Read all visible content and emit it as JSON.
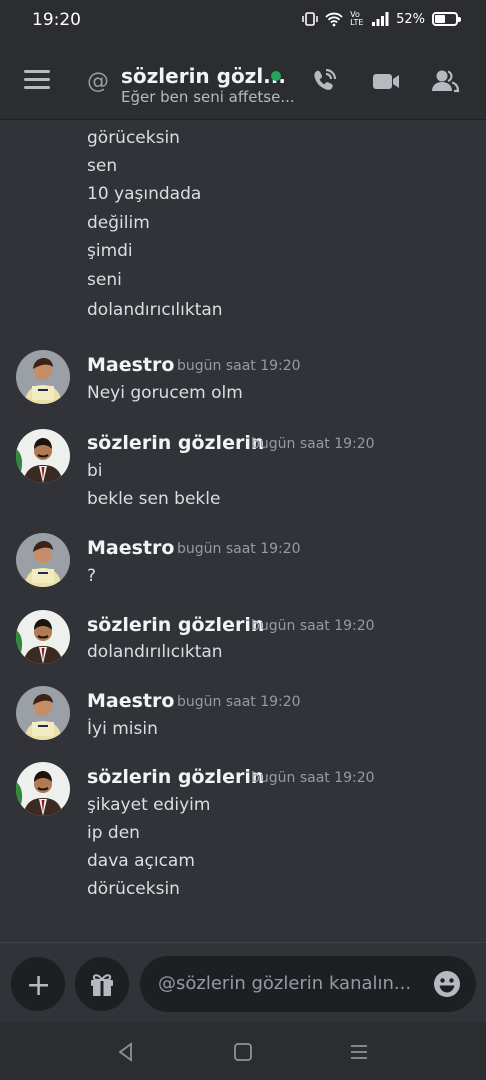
{
  "status_bar": {
    "time": "19:20",
    "battery": "52%",
    "battery_level": 0.52,
    "network_label": "Vo LTE"
  },
  "header": {
    "title": "sözlerin gözl...",
    "subtitle": "Eğer ben seni affetse...",
    "status": "online",
    "icons": [
      "menu-icon",
      "at-icon",
      "phone-call-icon",
      "video-camera-icon",
      "members-icon"
    ]
  },
  "continuation_lines": [
    "görüceksin",
    "sen",
    "10 yaşındada",
    "değilim",
    "şimdi",
    "seni",
    "dolandırıcılıktan"
  ],
  "messages": [
    {
      "author": "Maestro",
      "timestamp": "bugün saat 19:20",
      "lines": [
        "Neyi gorucem olm"
      ]
    },
    {
      "author": "sözlerin gözlerin",
      "timestamp": "bugün saat 19:20",
      "lines": [
        "bi",
        "bekle sen bekle"
      ]
    },
    {
      "author": "Maestro",
      "timestamp": "bugün saat 19:20",
      "lines": [
        "?"
      ]
    },
    {
      "author": "sözlerin gözlerin",
      "timestamp": "bugün saat 19:20",
      "lines": [
        "dolandırılıcıktan"
      ]
    },
    {
      "author": "Maestro",
      "timestamp": "bugün saat 19:20",
      "lines": [
        "İyi misin"
      ]
    },
    {
      "author": "sözlerin gözlerin",
      "timestamp": "bugün saat 19:20",
      "lines": [
        "şikayet ediyim",
        "ip  den",
        "dava açıcam",
        "dörüceksin"
      ]
    }
  ],
  "composer": {
    "placeholder": "@sözlerin gözlerin kanalın...",
    "plus_label": "+"
  },
  "colors": {
    "background": "#313338",
    "header_bg": "#2b2d31",
    "online": "#23a55a",
    "timestamp": "#949ba4"
  }
}
